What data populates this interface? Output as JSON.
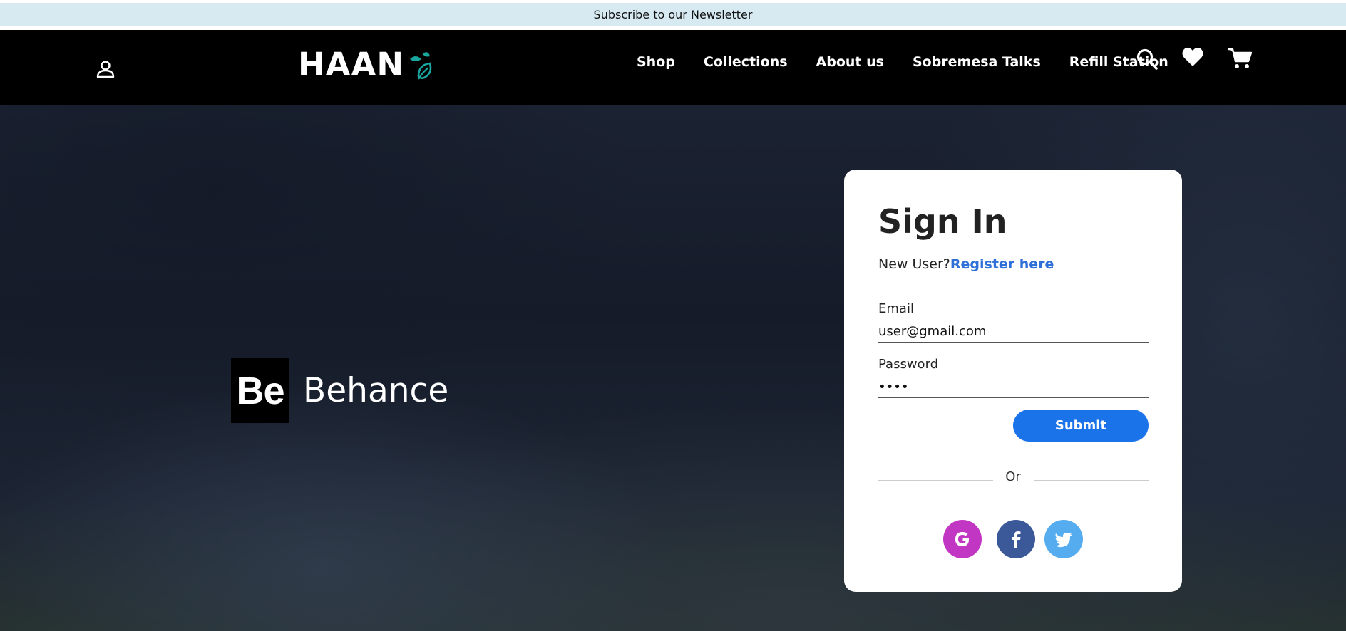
{
  "banner": {
    "text": "Subscribe to our Newsletter"
  },
  "header": {
    "logo_text": "HAAN",
    "nav": [
      {
        "label": "Shop"
      },
      {
        "label": "Collections"
      },
      {
        "label": "About us"
      },
      {
        "label": "Sobremesa Talks"
      },
      {
        "label": "Refill Station"
      }
    ],
    "icons": [
      "user-icon",
      "search-icon",
      "heart-icon",
      "cart-icon"
    ]
  },
  "hero": {
    "brand_mark": "Be",
    "brand_name": "Behance"
  },
  "signin": {
    "title": "Sign In",
    "new_user_text": "New User?",
    "register_link": "Register here",
    "email_label": "Email",
    "email_value": "user@gmail.com",
    "password_label": "Password",
    "password_value": "1234",
    "submit_label": "Submit",
    "divider_text": "Or",
    "social": [
      {
        "name": "google",
        "color": "#c236c4"
      },
      {
        "name": "facebook",
        "color": "#3b5998"
      },
      {
        "name": "twitter",
        "color": "#55acee"
      }
    ]
  },
  "colors": {
    "banner_bg": "#d7eaf2",
    "nav_bg": "#000000",
    "accent": "#1a73e8",
    "link": "#2e6fd8",
    "leaf": "#1aa7a0"
  }
}
